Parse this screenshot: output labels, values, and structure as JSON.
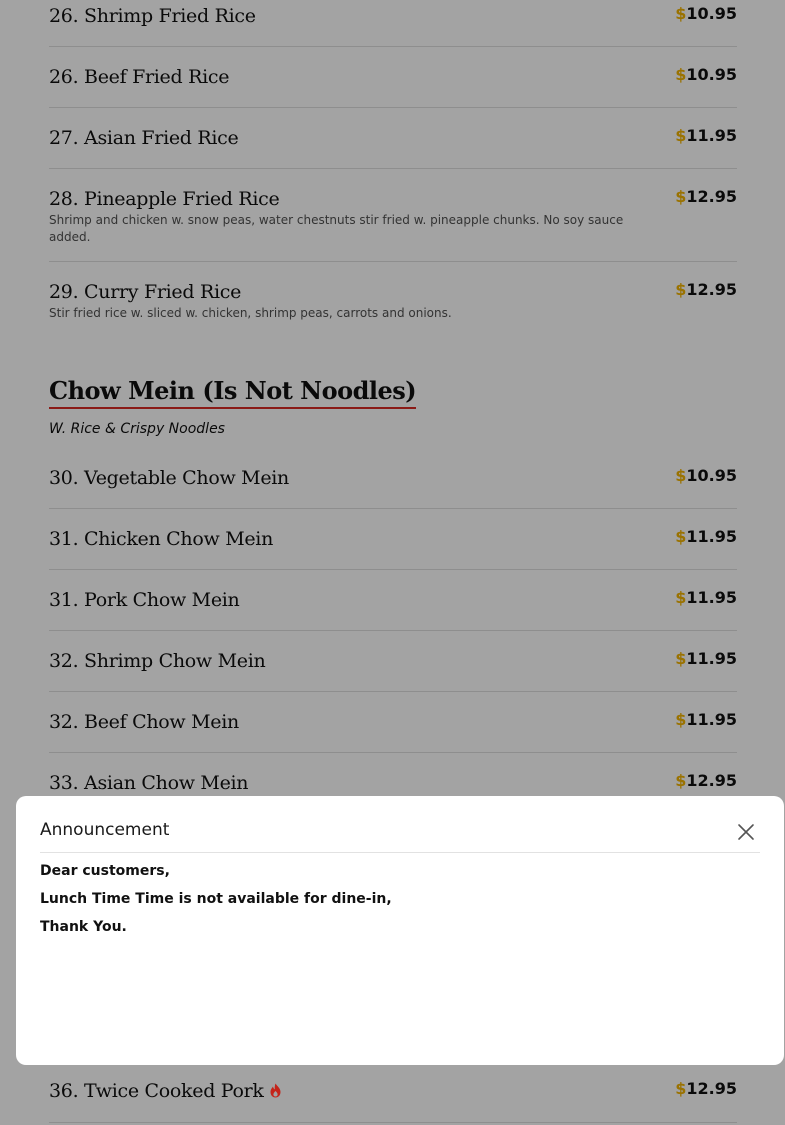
{
  "currency_symbol": "$",
  "colors": {
    "currency": "#9a7200",
    "section_underline": "#8a1a16",
    "spicy_icon": "#c4241a"
  },
  "fried_rice": {
    "items": [
      {
        "name": "26. Shrimp Fried Rice",
        "price": "10.95"
      },
      {
        "name": "26. Beef Fried Rice",
        "price": "10.95"
      },
      {
        "name": "27. Asian Fried Rice",
        "price": "11.95"
      },
      {
        "name": "28. Pineapple Fried Rice",
        "price": "12.95",
        "description": "Shrimp and chicken w. snow peas, water chestnuts stir fried w. pineapple chunks. No soy sauce added."
      },
      {
        "name": "29. Curry Fried Rice",
        "price": "12.95",
        "description": "Stir fried rice w. sliced w. chicken, shrimp peas, carrots and onions."
      }
    ]
  },
  "chow_mein": {
    "title": "Chow Mein (Is Not Noodles)",
    "subtitle": "W. Rice & Crispy Noodles",
    "items": [
      {
        "name": "30. Vegetable Chow Mein",
        "price": "10.95"
      },
      {
        "name": "31. Chicken Chow Mein",
        "price": "11.95"
      },
      {
        "name": "31. Pork Chow Mein",
        "price": "11.95"
      },
      {
        "name": "32. Shrimp Chow Mein",
        "price": "11.95"
      },
      {
        "name": "32. Beef Chow Mein",
        "price": "11.95"
      },
      {
        "name": "33. Asian Chow Mein",
        "price": "12.95"
      }
    ]
  },
  "next_item": {
    "name": "36. Twice Cooked Pork",
    "price": "12.95",
    "icon": "spicy-flame-icon"
  },
  "announcement": {
    "title": "Announcement",
    "close_icon": "close-icon",
    "lines": [
      "Dear customers,",
      "Lunch Time Time is not available for dine-in,",
      "Thank You."
    ]
  }
}
